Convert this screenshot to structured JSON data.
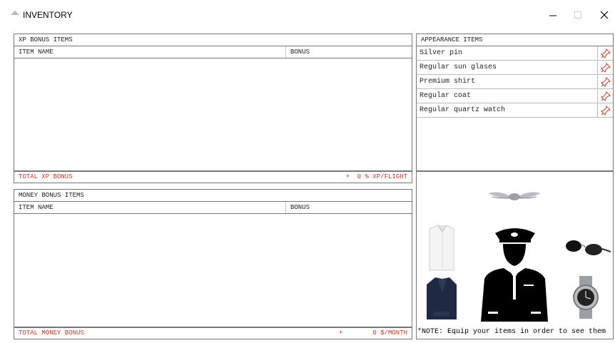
{
  "window": {
    "title": "INVENTORY",
    "icon": "airplane-icon",
    "controls": {
      "minimize": "—",
      "maximize": "□",
      "close": "✕"
    }
  },
  "xp_panel": {
    "header": "XP BONUS ITEMS",
    "columns": [
      "ITEM NAME",
      "BONUS"
    ],
    "rows": [],
    "total_label": "TOTAL XP BONUS",
    "total_value": "+  0 % XP/FLIGHT"
  },
  "money_panel": {
    "header": "MONEY BONUS ITEMS",
    "columns": [
      "ITEM NAME",
      "BONUS"
    ],
    "rows": [],
    "total_label": "TOTAL MONEY BONUS",
    "total_sign": "+",
    "total_value": "0 $/MONTH"
  },
  "appearance": {
    "header": "APPEARANCE ITEMS",
    "items": [
      {
        "name": "Silver pin",
        "icon": "pin-icon"
      },
      {
        "name": "Regular sun glases",
        "icon": "pin-icon"
      },
      {
        "name": "Premium shirt",
        "icon": "pin-icon"
      },
      {
        "name": "Regular coat",
        "icon": "pin-icon"
      },
      {
        "name": "Regular quartz watch",
        "icon": "pin-icon"
      }
    ],
    "note": "*NOTE: Equip your items in order to see them"
  },
  "colors": {
    "accent_red": "#c0392b",
    "border": "#777777"
  }
}
